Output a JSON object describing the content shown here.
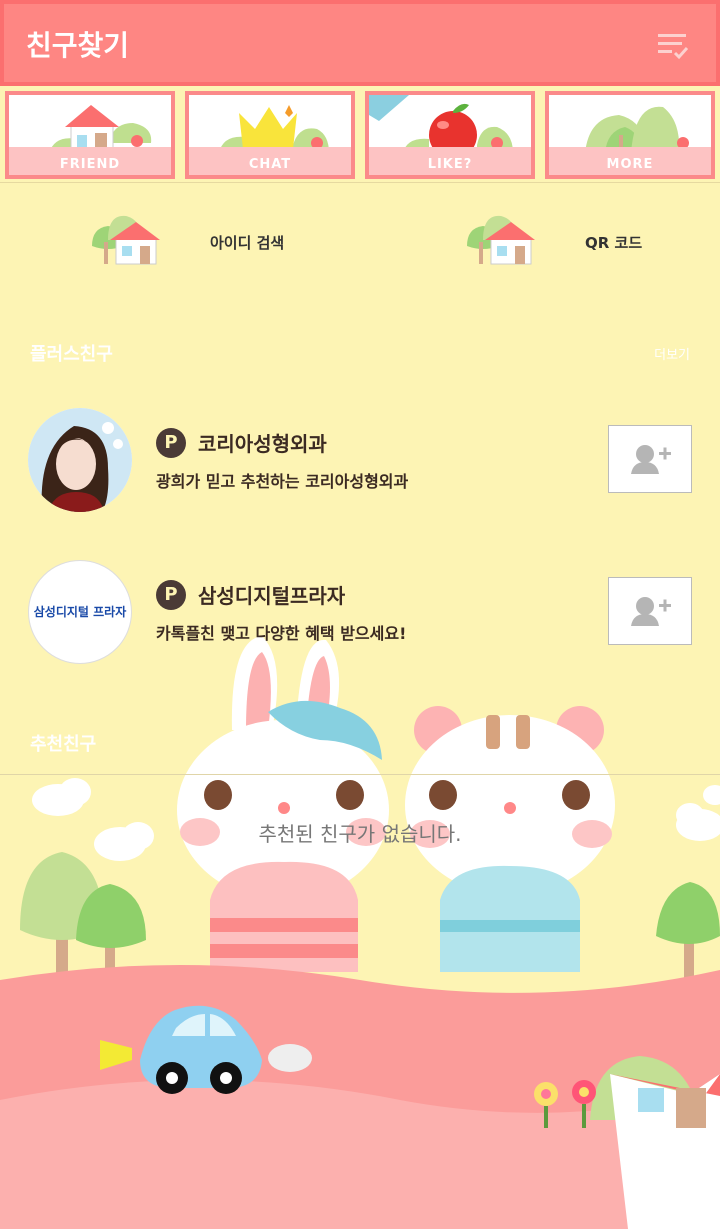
{
  "header": {
    "title": "친구찾기",
    "menu_icon": "checklist-menu-icon"
  },
  "tabs": [
    {
      "label": "FRIEND",
      "icon": "house-icon"
    },
    {
      "label": "CHAT",
      "icon": "crown-icon"
    },
    {
      "label": "LIKE?",
      "icon": "apple-icon"
    },
    {
      "label": "MORE",
      "icon": "trees-icon"
    }
  ],
  "search": [
    {
      "label": "아이디 검색",
      "icon": "house-icon"
    },
    {
      "label": "QR 코드",
      "icon": "house-icon"
    }
  ],
  "plus_friends": {
    "title": "플러스친구",
    "more": "더보기",
    "items": [
      {
        "name": "코리아성형외과",
        "desc": "광희가 믿고 추천하는 코리아성형외과",
        "badge": "P"
      },
      {
        "name": "삼성디지털프라자",
        "desc": "카톡플친 맺고 다양한 혜택 받으세요!",
        "badge": "P",
        "logo_text": "삼성디지털 프라자"
      }
    ]
  },
  "recommended": {
    "title": "추천친구",
    "empty": "추천된 친구가 없습니다."
  },
  "colors": {
    "header": "#fe8683",
    "background": "#fdf4b4",
    "badge": "#4a3a36"
  }
}
